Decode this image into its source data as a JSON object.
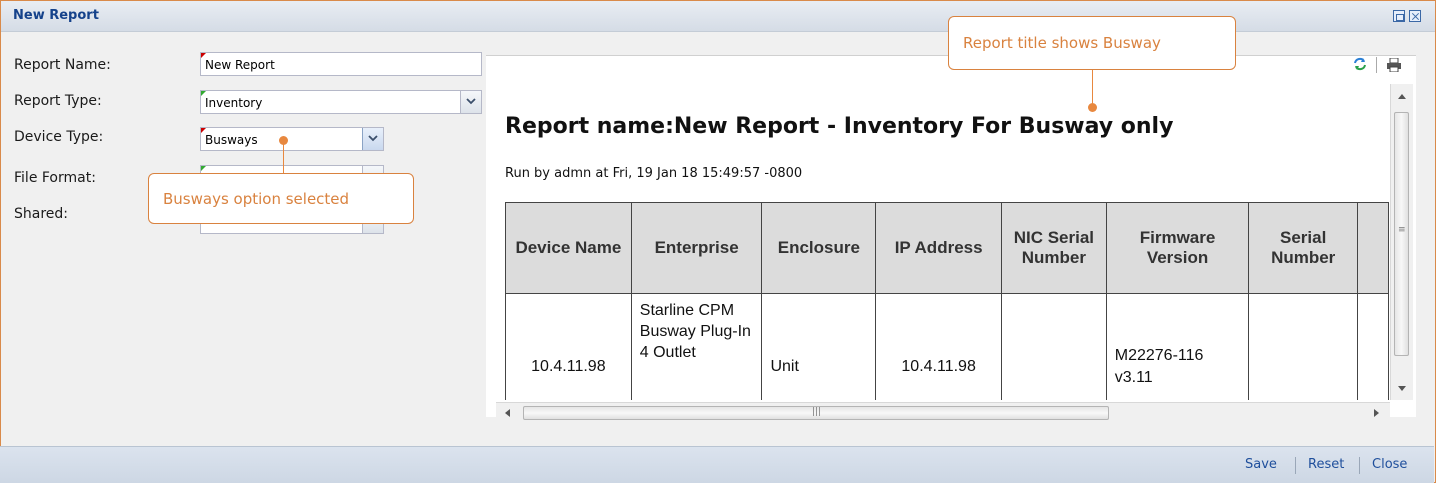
{
  "window": {
    "title": "New Report"
  },
  "form": {
    "report_name_label": "Report Name:",
    "report_name_value": "New Report",
    "report_type_label": "Report Type:",
    "report_type_value": "Inventory",
    "device_type_label": "Device Type:",
    "device_type_value": "Busways",
    "file_format_label": "File Format:",
    "shared_label": "Shared:"
  },
  "report": {
    "title": "Report name:New Report - Inventory For Busway only",
    "run_info": "Run by admn at Fri, 19 Jan 18 15:49:57 -0800",
    "columns": [
      "Device Name",
      "Enterprise",
      "Enclosure",
      "IP Address",
      "NIC Serial Number",
      "Firmware Version",
      "Serial Number"
    ],
    "rows": [
      {
        "device_name": "10.4.11.98",
        "enterprise": "Starline CPM Busway Plug-In 4 Outlet",
        "enclosure": "Unit",
        "ip_address": "10.4.11.98",
        "nic_serial_number": "",
        "firmware_version": "M22276-116 v3.11",
        "serial_number": ""
      }
    ]
  },
  "footer": {
    "save": "Save",
    "reset": "Reset",
    "close": "Close"
  },
  "annotations": {
    "callout_title": "Report title shows Busway",
    "callout_busways": "Busways option selected"
  },
  "colors": {
    "accent": "#e8883f",
    "link": "#1f4f9c",
    "title": "#15428b"
  }
}
